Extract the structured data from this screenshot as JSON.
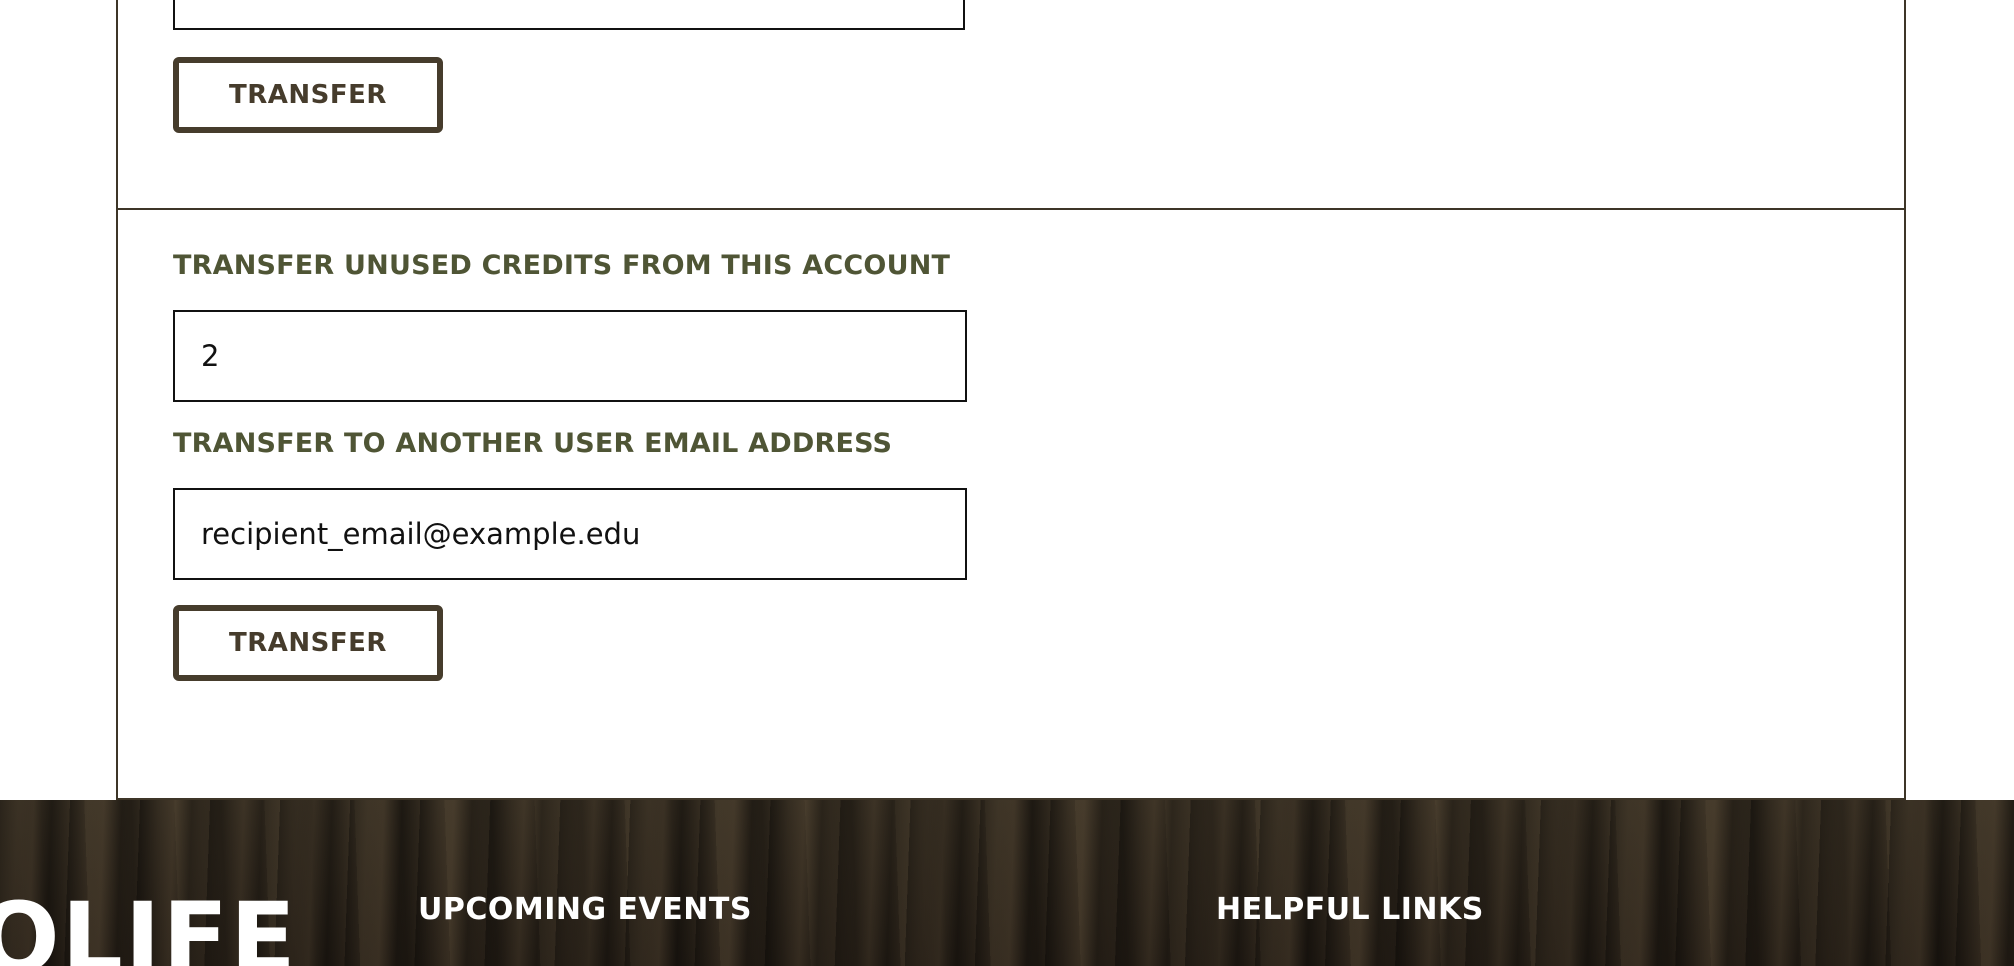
{
  "transfer_top": {
    "button_label": "TRANSFER"
  },
  "transfer_unused": {
    "credits_label": "TRANSFER UNUSED CREDITS FROM THIS ACCOUNT",
    "credits_value": "2",
    "email_label": "TRANSFER TO ANOTHER USER EMAIL ADDRESS",
    "email_value": "recipient_email@example.edu",
    "button_label": "TRANSFER"
  },
  "footer": {
    "logo_text": "OLIFE",
    "upcoming_events_heading": "UPCOMING EVENTS",
    "helpful_links_heading": "HELPFUL LINKS"
  },
  "colors": {
    "label_olive": "#4f5535",
    "button_brown": "#463c2c",
    "footer_bark": "#2f271d"
  }
}
